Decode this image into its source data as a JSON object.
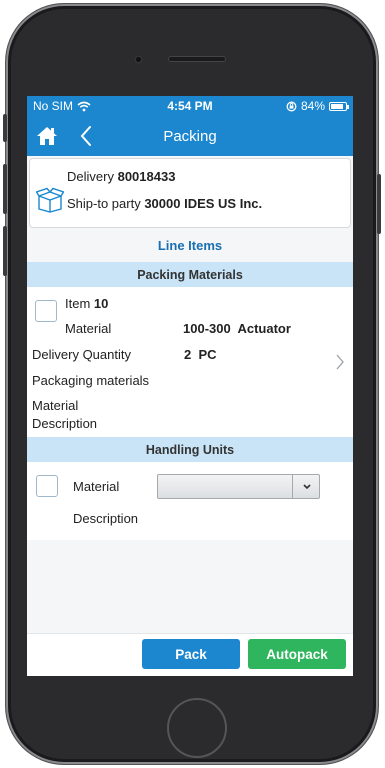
{
  "status_bar": {
    "carrier": "No SIM",
    "time": "4:54 PM",
    "battery": "84%",
    "battery_level": 0.84
  },
  "header": {
    "title": "Packing"
  },
  "delivery": {
    "delivery_label": "Delivery",
    "delivery_number": "80018433",
    "shipto_label": "Ship-to party",
    "shipto_value": "30000 IDES US Inc."
  },
  "line_items_link": "Line Items",
  "packing_materials": {
    "section_title": "Packing Materials",
    "item_label": "Item",
    "item_number": "10",
    "material_label": "Material",
    "material_value": "100-300  Actuator",
    "delivery_qty_label": "Delivery Quantity",
    "delivery_qty_value": "2  PC",
    "packaging_materials_label": "Packaging materials",
    "material_description_line1": "Material",
    "material_description_line2": "Description"
  },
  "handling_units": {
    "section_title": "Handling Units",
    "material_label": "Material",
    "description_label": "Description",
    "material_select_value": ""
  },
  "footer": {
    "pack_label": "Pack",
    "autopack_label": "Autopack"
  },
  "colors": {
    "brand_blue": "#1c87cf",
    "section_bar": "#c8e4f6",
    "autopack_green": "#2eb55e"
  }
}
